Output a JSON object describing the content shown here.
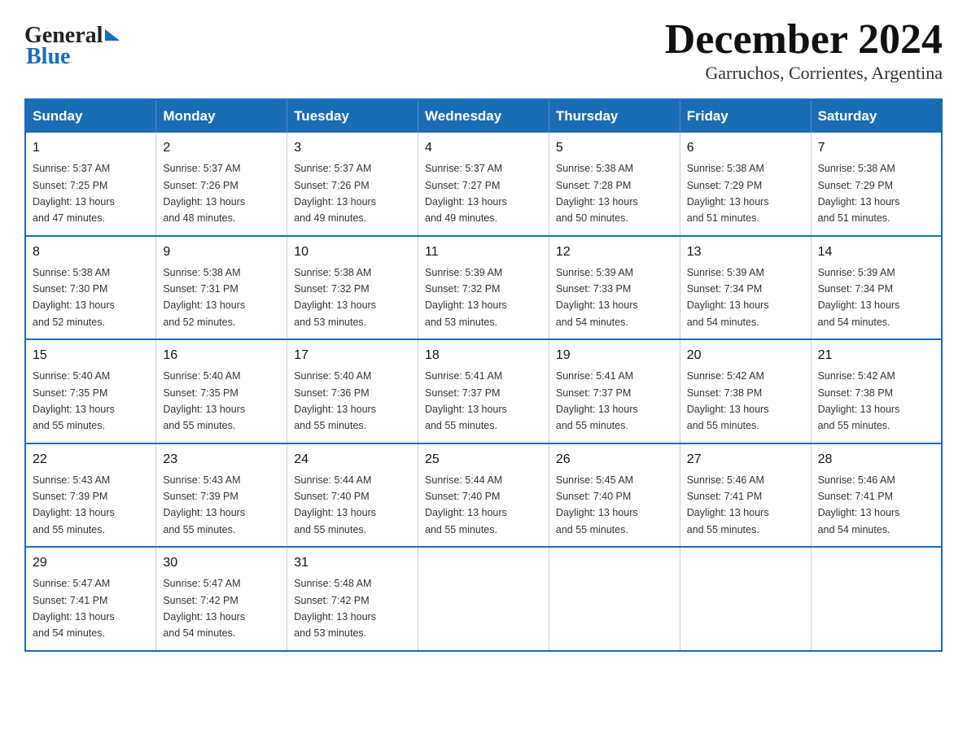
{
  "header": {
    "logo_general": "General",
    "logo_blue": "Blue",
    "month_title": "December 2024",
    "location": "Garruchos, Corrientes, Argentina"
  },
  "days_of_week": [
    "Sunday",
    "Monday",
    "Tuesday",
    "Wednesday",
    "Thursday",
    "Friday",
    "Saturday"
  ],
  "weeks": [
    [
      {
        "day": "1",
        "sunrise": "5:37 AM",
        "sunset": "7:25 PM",
        "daylight": "13 hours and 47 minutes."
      },
      {
        "day": "2",
        "sunrise": "5:37 AM",
        "sunset": "7:26 PM",
        "daylight": "13 hours and 48 minutes."
      },
      {
        "day": "3",
        "sunrise": "5:37 AM",
        "sunset": "7:26 PM",
        "daylight": "13 hours and 49 minutes."
      },
      {
        "day": "4",
        "sunrise": "5:37 AM",
        "sunset": "7:27 PM",
        "daylight": "13 hours and 49 minutes."
      },
      {
        "day": "5",
        "sunrise": "5:38 AM",
        "sunset": "7:28 PM",
        "daylight": "13 hours and 50 minutes."
      },
      {
        "day": "6",
        "sunrise": "5:38 AM",
        "sunset": "7:29 PM",
        "daylight": "13 hours and 51 minutes."
      },
      {
        "day": "7",
        "sunrise": "5:38 AM",
        "sunset": "7:29 PM",
        "daylight": "13 hours and 51 minutes."
      }
    ],
    [
      {
        "day": "8",
        "sunrise": "5:38 AM",
        "sunset": "7:30 PM",
        "daylight": "13 hours and 52 minutes."
      },
      {
        "day": "9",
        "sunrise": "5:38 AM",
        "sunset": "7:31 PM",
        "daylight": "13 hours and 52 minutes."
      },
      {
        "day": "10",
        "sunrise": "5:38 AM",
        "sunset": "7:32 PM",
        "daylight": "13 hours and 53 minutes."
      },
      {
        "day": "11",
        "sunrise": "5:39 AM",
        "sunset": "7:32 PM",
        "daylight": "13 hours and 53 minutes."
      },
      {
        "day": "12",
        "sunrise": "5:39 AM",
        "sunset": "7:33 PM",
        "daylight": "13 hours and 54 minutes."
      },
      {
        "day": "13",
        "sunrise": "5:39 AM",
        "sunset": "7:34 PM",
        "daylight": "13 hours and 54 minutes."
      },
      {
        "day": "14",
        "sunrise": "5:39 AM",
        "sunset": "7:34 PM",
        "daylight": "13 hours and 54 minutes."
      }
    ],
    [
      {
        "day": "15",
        "sunrise": "5:40 AM",
        "sunset": "7:35 PM",
        "daylight": "13 hours and 55 minutes."
      },
      {
        "day": "16",
        "sunrise": "5:40 AM",
        "sunset": "7:35 PM",
        "daylight": "13 hours and 55 minutes."
      },
      {
        "day": "17",
        "sunrise": "5:40 AM",
        "sunset": "7:36 PM",
        "daylight": "13 hours and 55 minutes."
      },
      {
        "day": "18",
        "sunrise": "5:41 AM",
        "sunset": "7:37 PM",
        "daylight": "13 hours and 55 minutes."
      },
      {
        "day": "19",
        "sunrise": "5:41 AM",
        "sunset": "7:37 PM",
        "daylight": "13 hours and 55 minutes."
      },
      {
        "day": "20",
        "sunrise": "5:42 AM",
        "sunset": "7:38 PM",
        "daylight": "13 hours and 55 minutes."
      },
      {
        "day": "21",
        "sunrise": "5:42 AM",
        "sunset": "7:38 PM",
        "daylight": "13 hours and 55 minutes."
      }
    ],
    [
      {
        "day": "22",
        "sunrise": "5:43 AM",
        "sunset": "7:39 PM",
        "daylight": "13 hours and 55 minutes."
      },
      {
        "day": "23",
        "sunrise": "5:43 AM",
        "sunset": "7:39 PM",
        "daylight": "13 hours and 55 minutes."
      },
      {
        "day": "24",
        "sunrise": "5:44 AM",
        "sunset": "7:40 PM",
        "daylight": "13 hours and 55 minutes."
      },
      {
        "day": "25",
        "sunrise": "5:44 AM",
        "sunset": "7:40 PM",
        "daylight": "13 hours and 55 minutes."
      },
      {
        "day": "26",
        "sunrise": "5:45 AM",
        "sunset": "7:40 PM",
        "daylight": "13 hours and 55 minutes."
      },
      {
        "day": "27",
        "sunrise": "5:46 AM",
        "sunset": "7:41 PM",
        "daylight": "13 hours and 55 minutes."
      },
      {
        "day": "28",
        "sunrise": "5:46 AM",
        "sunset": "7:41 PM",
        "daylight": "13 hours and 54 minutes."
      }
    ],
    [
      {
        "day": "29",
        "sunrise": "5:47 AM",
        "sunset": "7:41 PM",
        "daylight": "13 hours and 54 minutes."
      },
      {
        "day": "30",
        "sunrise": "5:47 AM",
        "sunset": "7:42 PM",
        "daylight": "13 hours and 54 minutes."
      },
      {
        "day": "31",
        "sunrise": "5:48 AM",
        "sunset": "7:42 PM",
        "daylight": "13 hours and 53 minutes."
      },
      null,
      null,
      null,
      null
    ]
  ],
  "labels": {
    "sunrise": "Sunrise:",
    "sunset": "Sunset:",
    "daylight": "Daylight:"
  }
}
